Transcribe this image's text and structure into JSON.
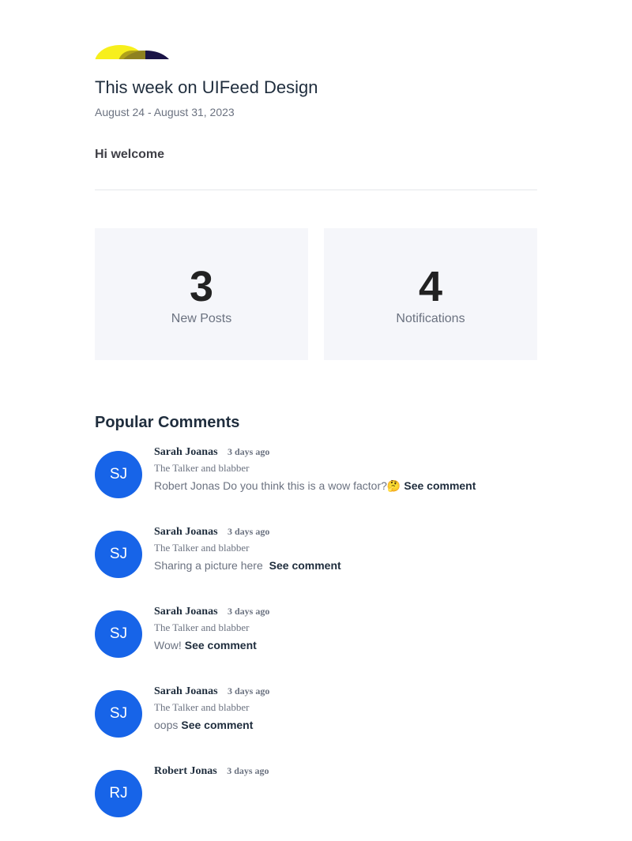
{
  "header": {
    "title": "This week on UIFeed Design",
    "date_range": "August 24 - August 31, 2023",
    "greeting": "Hi welcome"
  },
  "stats": [
    {
      "value": "3",
      "label": "New Posts"
    },
    {
      "value": "4",
      "label": "Notifications"
    }
  ],
  "section_title": "Popular Comments",
  "see_comment_label": "See comment",
  "comments": [
    {
      "initials": "SJ",
      "author": "Sarah Joanas",
      "time": "3 days ago",
      "role": "The Talker and blabber",
      "text": " Robert Jonas  Do you think this is a wow factor?🤔"
    },
    {
      "initials": "SJ",
      "author": "Sarah Joanas",
      "time": "3 days ago",
      "role": "The Talker and blabber",
      "text": "Sharing a picture here "
    },
    {
      "initials": "SJ",
      "author": "Sarah Joanas",
      "time": "3 days ago",
      "role": "The Talker and blabber",
      "text": "Wow!"
    },
    {
      "initials": "SJ",
      "author": "Sarah Joanas",
      "time": "3 days ago",
      "role": "The Talker and blabber",
      "text": "oops"
    },
    {
      "initials": "RJ",
      "author": "Robert Jonas",
      "time": "3 days ago",
      "role": "",
      "text": ""
    }
  ],
  "colors": {
    "avatar": "#1764e8",
    "logo_yellow": "#f7ef1c",
    "logo_navy": "#1a1446",
    "stat_card_bg": "#f5f6fa"
  }
}
